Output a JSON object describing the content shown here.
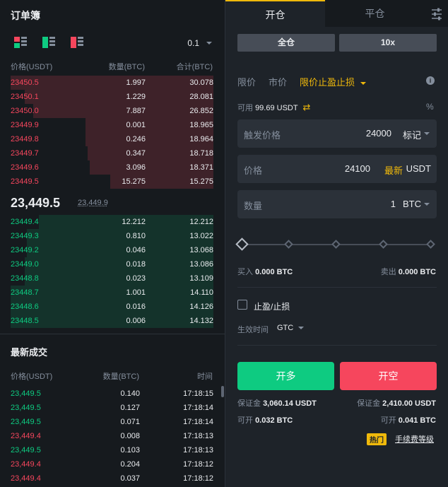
{
  "orderbook": {
    "title": "订单簿",
    "precision": "0.1",
    "headers": {
      "price": "价格(USDT)",
      "qty": "数量(BTC)",
      "total": "合计(BTC)"
    },
    "asks": [
      {
        "price": "23450.5",
        "qty": "1.997",
        "total": "30.078",
        "depth": 1.0
      },
      {
        "price": "23450.1",
        "qty": "1.229",
        "total": "28.081",
        "depth": 0.93
      },
      {
        "price": "23450.0",
        "qty": "7.887",
        "total": "26.852",
        "depth": 0.89
      },
      {
        "price": "23449.9",
        "qty": "0.001",
        "total": "18.965",
        "depth": 0.63
      },
      {
        "price": "23449.8",
        "qty": "0.246",
        "total": "18.964",
        "depth": 0.63
      },
      {
        "price": "23449.7",
        "qty": "0.347",
        "total": "18.718",
        "depth": 0.62
      },
      {
        "price": "23449.6",
        "qty": "3.096",
        "total": "18.371",
        "depth": 0.61
      },
      {
        "price": "23449.5",
        "qty": "15.275",
        "total": "15.275",
        "depth": 0.51
      }
    ],
    "last_price": "23,449.5",
    "mark_price": "23,449.9",
    "bids": [
      {
        "price": "23449.4",
        "qty": "12.212",
        "total": "12.212",
        "depth": 0.86
      },
      {
        "price": "23449.3",
        "qty": "0.810",
        "total": "13.022",
        "depth": 0.92
      },
      {
        "price": "23449.2",
        "qty": "0.046",
        "total": "13.068",
        "depth": 0.92
      },
      {
        "price": "23449.0",
        "qty": "0.018",
        "total": "13.086",
        "depth": 0.93
      },
      {
        "price": "23448.8",
        "qty": "0.023",
        "total": "13.109",
        "depth": 0.93
      },
      {
        "price": "23448.7",
        "qty": "1.001",
        "total": "14.110",
        "depth": 1.0
      },
      {
        "price": "23448.6",
        "qty": "0.016",
        "total": "14.126",
        "depth": 1.0
      },
      {
        "price": "23448.5",
        "qty": "0.006",
        "total": "14.132",
        "depth": 1.0
      }
    ]
  },
  "trades": {
    "title": "最新成交",
    "headers": {
      "price": "价格(USDT)",
      "qty": "数量(BTC)",
      "time": "时间"
    },
    "rows": [
      {
        "price": "23,449.5",
        "qty": "0.140",
        "time": "17:18:15",
        "side": "buy"
      },
      {
        "price": "23,449.5",
        "qty": "0.127",
        "time": "17:18:14",
        "side": "buy"
      },
      {
        "price": "23,449.5",
        "qty": "0.071",
        "time": "17:18:14",
        "side": "buy"
      },
      {
        "price": "23,449.4",
        "qty": "0.008",
        "time": "17:18:13",
        "side": "sell"
      },
      {
        "price": "23,449.5",
        "qty": "0.103",
        "time": "17:18:13",
        "side": "buy"
      },
      {
        "price": "23,449.4",
        "qty": "0.204",
        "time": "17:18:12",
        "side": "sell"
      },
      {
        "price": "23,449.4",
        "qty": "0.037",
        "time": "17:18:12",
        "side": "sell"
      }
    ]
  },
  "trade_panel": {
    "tab_open": "开仓",
    "tab_close": "平仓",
    "margin_mode": "全仓",
    "leverage": "10x",
    "order_types": {
      "limit": "限价",
      "market": "市价",
      "stop_limit": "限价止盈止损"
    },
    "available_label": "可用",
    "available_value": "99.69 USDT",
    "trigger": {
      "label": "触发价格",
      "value": "24000",
      "unit": "标记"
    },
    "price": {
      "label": "价格",
      "value": "24100",
      "tag": "最新",
      "unit": "USDT"
    },
    "quantity": {
      "label": "数量",
      "value": "1",
      "unit": "BTC"
    },
    "slider_value": 0,
    "buy_label": "买入",
    "buy_value": "0.000 BTC",
    "sell_label": "卖出",
    "sell_value": "0.000 BTC",
    "tpsl_label": "止盈/止损",
    "tif_label": "生效时间",
    "tif_value": "GTC",
    "long_button": "开多",
    "short_button": "开空",
    "margin_long_label": "保证金",
    "margin_long_value": "3,060.14 USDT",
    "margin_short_label": "保证金",
    "margin_short_value": "2,410.00 USDT",
    "can_open_long_label": "可开",
    "can_open_long_value": "0.032 BTC",
    "can_open_short_label": "可开",
    "can_open_short_value": "0.041 BTC",
    "hot_badge": "热门",
    "fee_link": "手续费等级"
  },
  "colors": {
    "up": "#0ecb81",
    "down": "#f6465d",
    "accent": "#f0b90b"
  }
}
